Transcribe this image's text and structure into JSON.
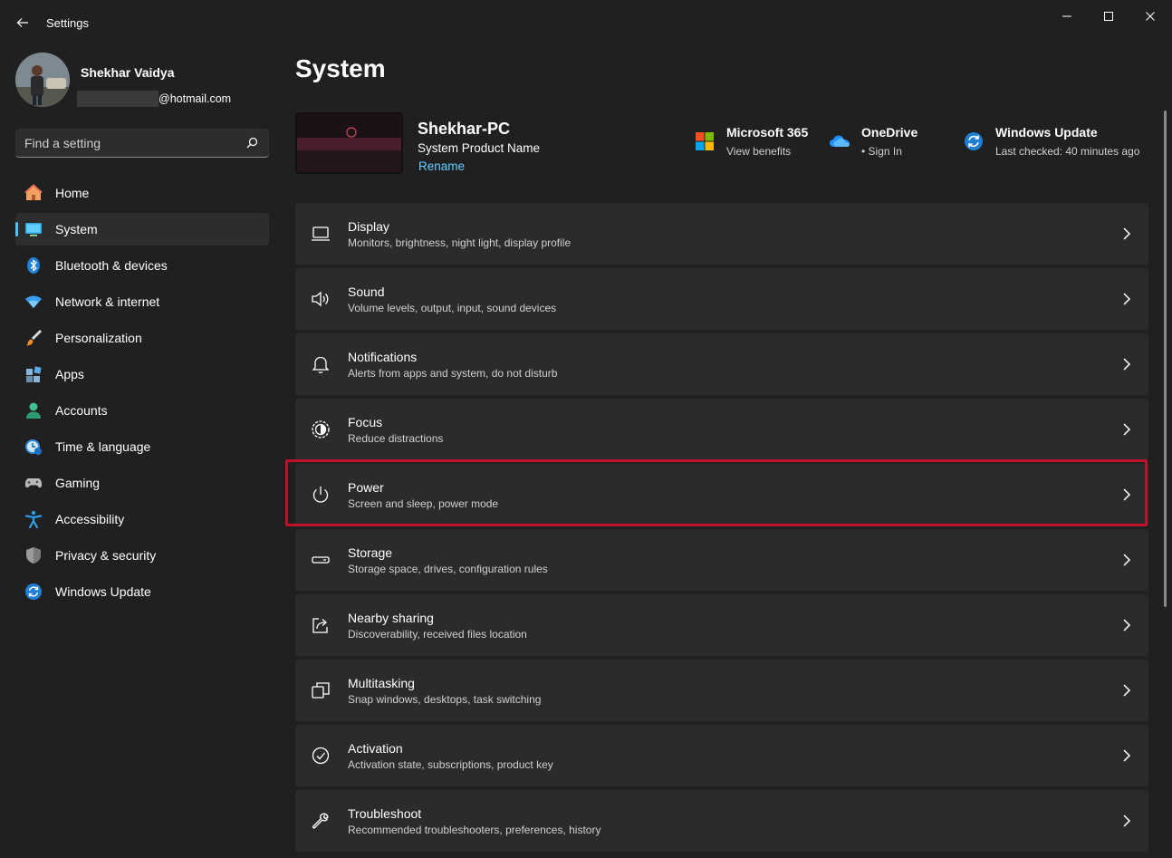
{
  "window": {
    "title": "Settings"
  },
  "profile": {
    "name": "Shekhar Vaidya",
    "email_domain": "@hotmail.com"
  },
  "search": {
    "placeholder": "Find a setting",
    "value": ""
  },
  "sidebar": {
    "items": [
      {
        "label": "Home",
        "icon": "home-icon",
        "active": false
      },
      {
        "label": "System",
        "icon": "system-icon",
        "active": true
      },
      {
        "label": "Bluetooth & devices",
        "icon": "bluetooth-icon",
        "active": false
      },
      {
        "label": "Network & internet",
        "icon": "wifi-icon",
        "active": false
      },
      {
        "label": "Personalization",
        "icon": "brush-icon",
        "active": false
      },
      {
        "label": "Apps",
        "icon": "apps-icon",
        "active": false
      },
      {
        "label": "Accounts",
        "icon": "accounts-icon",
        "active": false
      },
      {
        "label": "Time & language",
        "icon": "time-language-icon",
        "active": false
      },
      {
        "label": "Gaming",
        "icon": "gamepad-icon",
        "active": false
      },
      {
        "label": "Accessibility",
        "icon": "accessibility-icon",
        "active": false
      },
      {
        "label": "Privacy & security",
        "icon": "shield-icon",
        "active": false
      },
      {
        "label": "Windows Update",
        "icon": "windows-update-icon",
        "active": false
      }
    ]
  },
  "main": {
    "title": "System",
    "device": {
      "name": "Shekhar-PC",
      "model": "System Product Name",
      "rename": "Rename"
    },
    "quick": [
      {
        "title": "Microsoft 365",
        "sub": "View benefits",
        "icon": "microsoft-365-icon"
      },
      {
        "title": "OneDrive",
        "sub": "• Sign In",
        "icon": "onedrive-icon"
      },
      {
        "title": "Windows Update",
        "sub": "Last checked: 40 minutes ago",
        "icon": "windows-update-icon"
      }
    ],
    "cards": [
      {
        "title": "Display",
        "sub": "Monitors, brightness, night light, display profile",
        "icon": "display-icon"
      },
      {
        "title": "Sound",
        "sub": "Volume levels, output, input, sound devices",
        "icon": "sound-icon"
      },
      {
        "title": "Notifications",
        "sub": "Alerts from apps and system, do not disturb",
        "icon": "bell-icon"
      },
      {
        "title": "Focus",
        "sub": "Reduce distractions",
        "icon": "focus-icon"
      },
      {
        "title": "Power",
        "sub": "Screen and sleep, power mode",
        "icon": "power-icon"
      },
      {
        "title": "Storage",
        "sub": "Storage space, drives, configuration rules",
        "icon": "storage-icon"
      },
      {
        "title": "Nearby sharing",
        "sub": "Discoverability, received files location",
        "icon": "share-icon"
      },
      {
        "title": "Multitasking",
        "sub": "Snap windows, desktops, task switching",
        "icon": "multitasking-icon"
      },
      {
        "title": "Activation",
        "sub": "Activation state, subscriptions, product key",
        "icon": "check-circle-icon"
      },
      {
        "title": "Troubleshoot",
        "sub": "Recommended troubleshooters, preferences, history",
        "icon": "wrench-icon"
      }
    ]
  },
  "colors": {
    "accent": "#4cc2ff",
    "link": "#60cdff",
    "highlight": "#c0102a",
    "card": "#2b2b2b",
    "background": "#202020"
  }
}
